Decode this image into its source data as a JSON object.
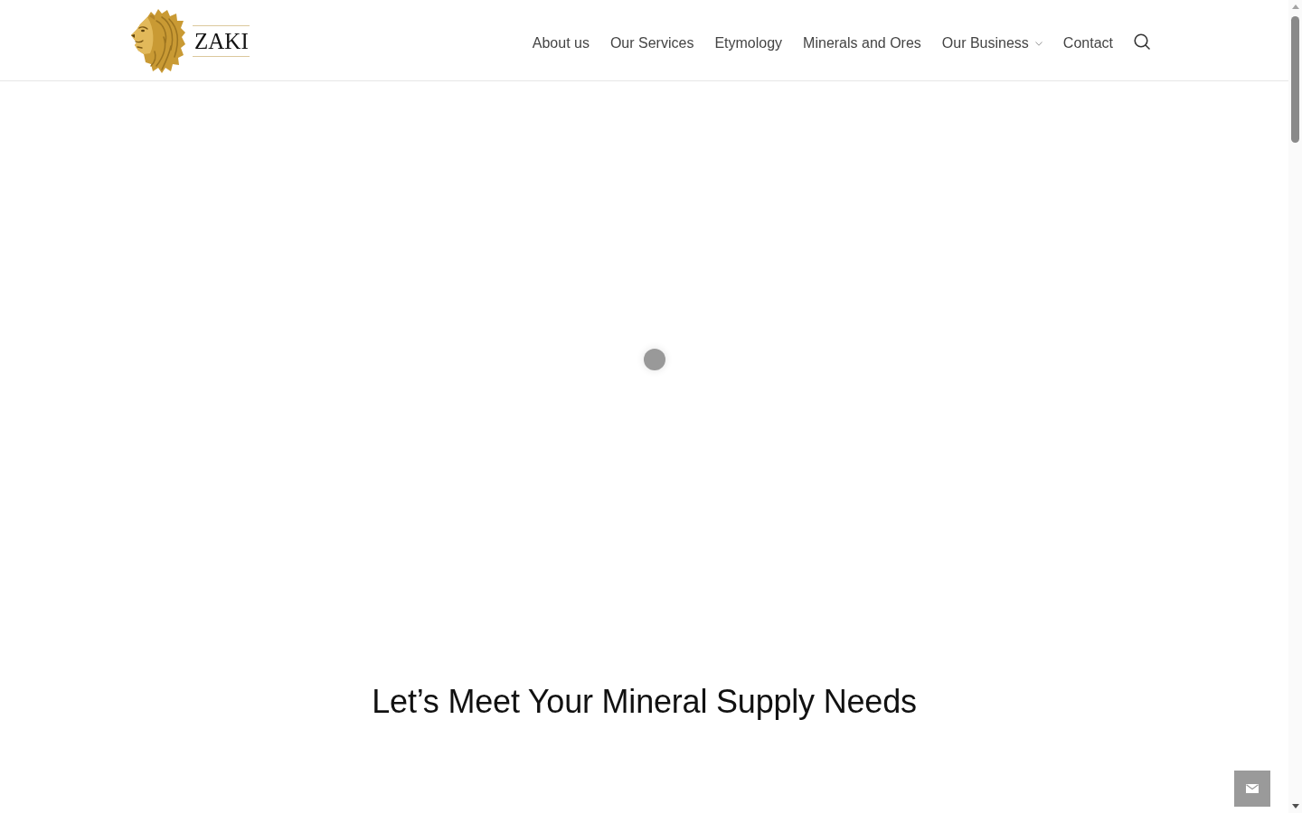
{
  "header": {
    "logo": {
      "wordmark": "ZAKI"
    },
    "nav": [
      {
        "label": "About us",
        "has_submenu": false
      },
      {
        "label": "Our Services",
        "has_submenu": false
      },
      {
        "label": "Etymology",
        "has_submenu": false
      },
      {
        "label": "Minerals and Ores",
        "has_submenu": false
      },
      {
        "label": "Our Business",
        "has_submenu": true
      },
      {
        "label": "Contact",
        "has_submenu": false
      }
    ]
  },
  "section": {
    "heading": "Let’s Meet Your Mineral Supply Needs"
  }
}
